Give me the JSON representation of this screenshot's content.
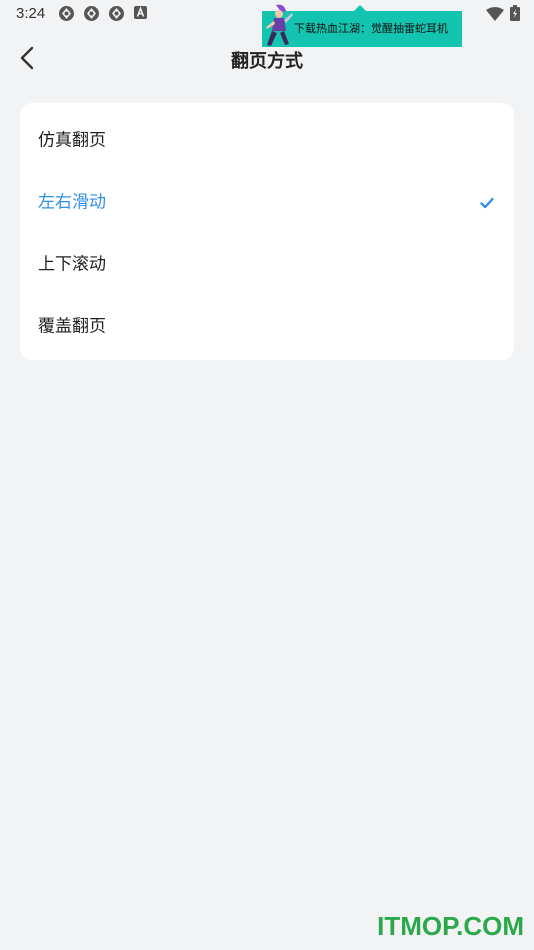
{
  "status_bar": {
    "time": "3:24",
    "notification_icons": [
      "aperture-icon",
      "aperture-icon",
      "aperture-icon",
      "a-square-icon"
    ],
    "right_icons": [
      "wifi-icon",
      "battery-icon"
    ]
  },
  "ad_banner": {
    "text": "下载热血江湖：觉醒抽雷蛇耳机",
    "color": "#13c4b0"
  },
  "header": {
    "back_icon": "chevron-left-icon",
    "title": "翻页方式"
  },
  "options": {
    "items": [
      {
        "label": "仿真翻页",
        "selected": false
      },
      {
        "label": "左右滑动",
        "selected": true
      },
      {
        "label": "上下滚动",
        "selected": false
      },
      {
        "label": "覆盖翻页",
        "selected": false
      }
    ],
    "selected_color": "#2f8fe8",
    "check_icon": "checkmark-icon"
  },
  "watermark": {
    "text": "ITMOP.COM"
  }
}
